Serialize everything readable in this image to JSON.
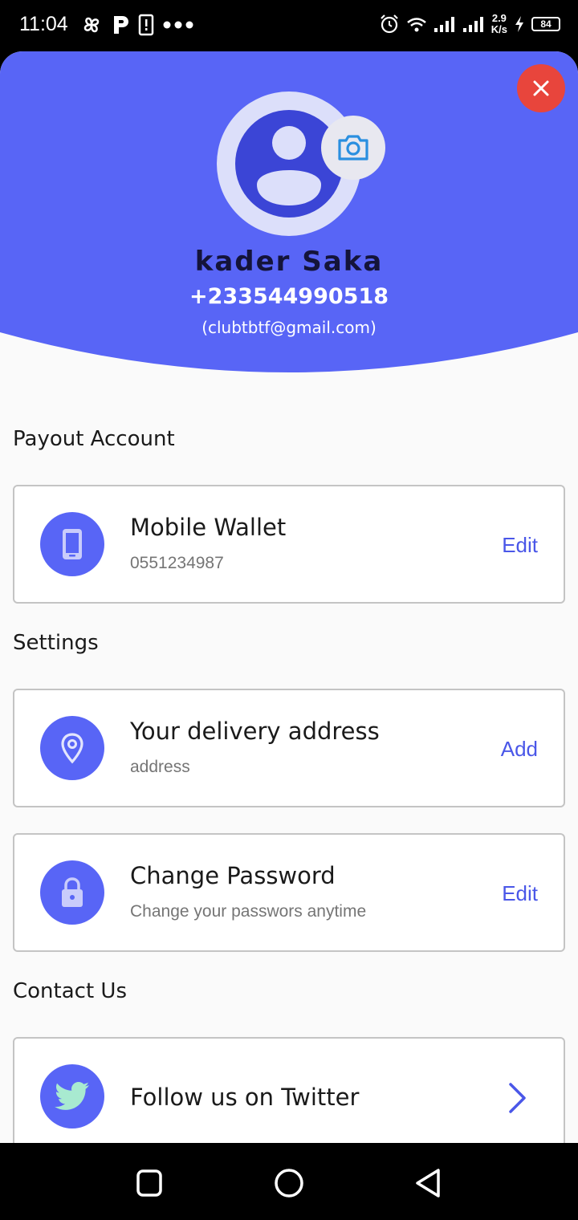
{
  "status_bar": {
    "time": "11:04",
    "speed_value": "2.9",
    "speed_unit": "K/s",
    "battery": "84"
  },
  "profile": {
    "name": "kader Saka",
    "phone": "+233544990518",
    "email": "(clubtbtf@gmail.com)"
  },
  "sections": {
    "payout_title": "Payout Account",
    "settings_title": "Settings",
    "contact_title": "Contact Us"
  },
  "payout_card": {
    "title": "Mobile Wallet",
    "subtitle": "0551234987",
    "action": "Edit"
  },
  "delivery_card": {
    "title": "Your delivery address",
    "subtitle": "address",
    "action": "Add"
  },
  "password_card": {
    "title": "Change Password",
    "subtitle": "Change your passwors anytime",
    "action": "Edit"
  },
  "twitter_card": {
    "title": "Follow us on Twitter"
  },
  "colors": {
    "header": "#5865f6",
    "accent": "#4a57e8",
    "close": "#e8453c"
  }
}
